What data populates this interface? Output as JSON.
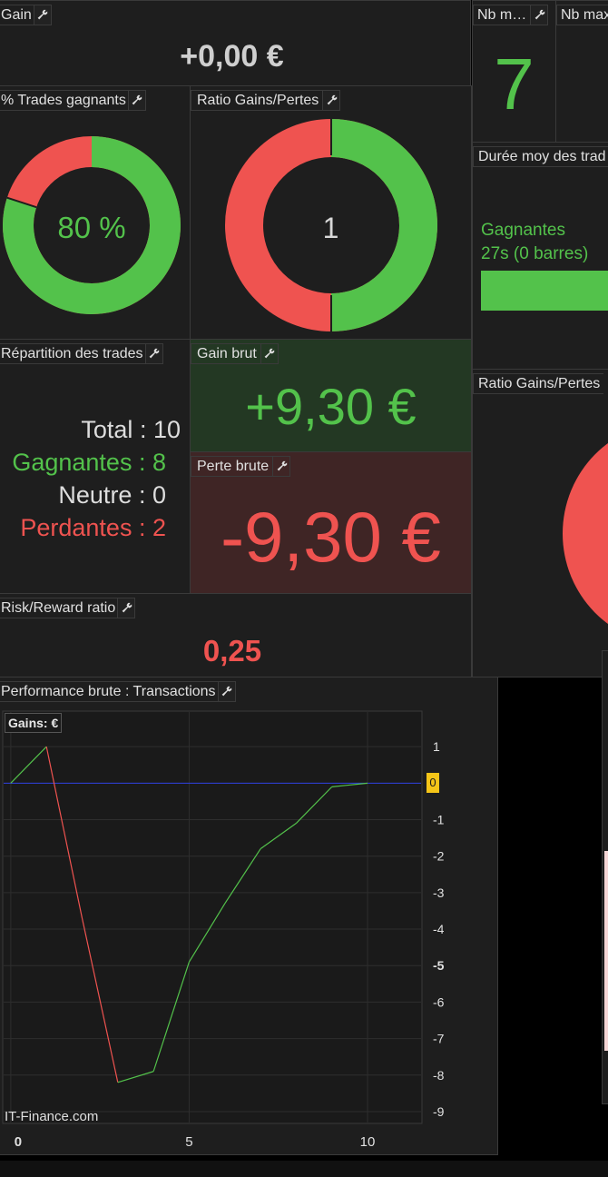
{
  "colors": {
    "green": "#53c24b",
    "red": "#ef5350",
    "bg": "#1e1e1e"
  },
  "gain": {
    "title": "Gain",
    "value": "+0,00 €"
  },
  "nb_max1": {
    "title": "Nb m…",
    "value": "7"
  },
  "nb_max2": {
    "title": "Nb max"
  },
  "trades_gagnants": {
    "title": "% Trades gagnants",
    "value": "80 %",
    "percent": 80
  },
  "ratio_gp": {
    "title": "Ratio Gains/Pertes",
    "value": "1",
    "percent_gains": 50
  },
  "duree": {
    "title": "Durée moy des trad",
    "label": "Gagnantes",
    "value": "27s (0 barres)"
  },
  "ratio_gp2": {
    "title": "Ratio Gains/Pertes"
  },
  "repartition": {
    "title": "Répartition des trades",
    "rows": [
      {
        "label": "Total",
        "value": "10"
      },
      {
        "label": "Gagnantes",
        "value": "8"
      },
      {
        "label": "Neutre",
        "value": "0"
      },
      {
        "label": "Perdantes",
        "value": "2"
      }
    ]
  },
  "gain_brut": {
    "title": "Gain brut",
    "value": "+9,30 €"
  },
  "perte_brute": {
    "title": "Perte brute",
    "value": "-9,30 €"
  },
  "risk_reward": {
    "title": "Risk/Reward ratio",
    "value": "0,25"
  },
  "performance": {
    "title": "Performance brute : Transactions",
    "legend": "Gains: €",
    "watermark": "IT-Finance.com",
    "current_value_label": "0"
  },
  "chart_data": {
    "type": "line",
    "x": [
      0,
      1,
      2,
      3,
      4,
      5,
      6,
      7,
      8,
      9,
      10
    ],
    "values": [
      0,
      1.0,
      -3.7,
      -8.2,
      -7.9,
      -4.9,
      -3.3,
      -1.8,
      -1.1,
      -0.1,
      0
    ],
    "xlim": [
      -0.2,
      11.5
    ],
    "ylim": [
      -9.3,
      1.95
    ],
    "x_ticks": [
      "0",
      "5",
      "10"
    ],
    "x_tick_values": [
      0,
      5,
      10
    ],
    "y_ticks": [
      "1",
      "0",
      "-1",
      "-2",
      "-3",
      "-4",
      "-5",
      "-6",
      "-7",
      "-8",
      "-9"
    ],
    "y_tick_values": [
      1,
      0,
      -1,
      -2,
      -3,
      -4,
      -5,
      -6,
      -7,
      -8,
      -9
    ],
    "grid": true,
    "zero_line_color": "#2d3fe0"
  }
}
